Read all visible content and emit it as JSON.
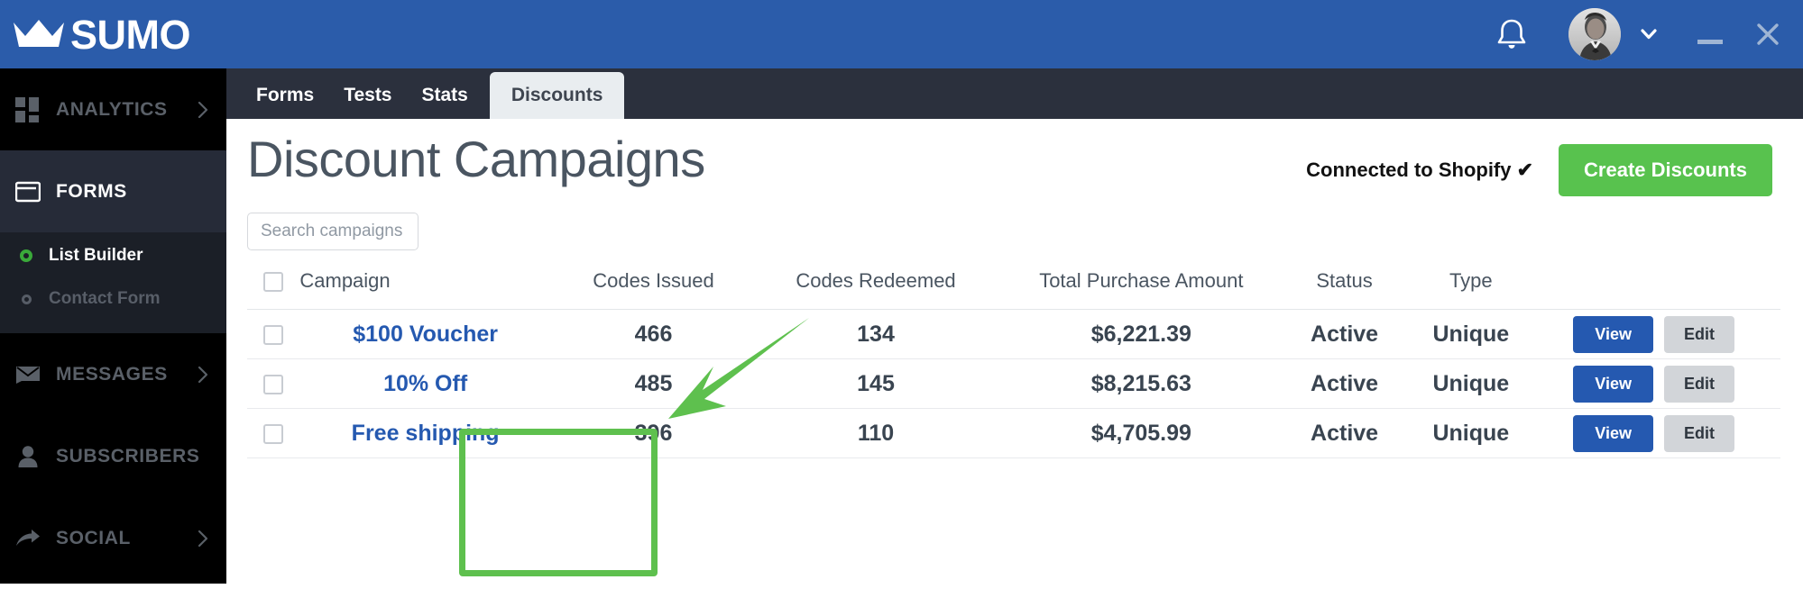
{
  "app": {
    "brand": "SUMO",
    "logo_icon": "crown-icon"
  },
  "titlebar": {
    "notifications_icon": "bell-icon",
    "avatar_icon": "user-avatar",
    "account_chevron_icon": "chevron-down-icon",
    "minimize_label": "–",
    "close_label": "✕"
  },
  "sidebar": {
    "items": [
      {
        "label": "ANALYTICS",
        "icon": "grid-icon",
        "has_chevron": true,
        "active": false
      },
      {
        "label": "FORMS",
        "icon": "window-icon",
        "has_chevron": false,
        "active": true
      },
      {
        "label": "MESSAGES",
        "icon": "envelope-icon",
        "has_chevron": true,
        "active": false
      },
      {
        "label": "SUBSCRIBERS",
        "icon": "person-icon",
        "has_chevron": false,
        "active": false
      },
      {
        "label": "SOCIAL",
        "icon": "share-arrow-icon",
        "has_chevron": true,
        "active": false
      }
    ],
    "subitems": [
      {
        "label": "List Builder",
        "active": true
      },
      {
        "label": "Contact Form",
        "active": false
      }
    ]
  },
  "tabs": [
    {
      "label": "Forms",
      "active": false
    },
    {
      "label": "Tests",
      "active": false
    },
    {
      "label": "Stats",
      "active": false
    },
    {
      "label": "Discounts",
      "active": true
    }
  ],
  "main": {
    "title": "Discount Campaigns",
    "shopify_status": "Connected to Shopify ✔",
    "create_button": "Create Discounts",
    "search_placeholder": "Search campaigns"
  },
  "table": {
    "headers": {
      "campaign": "Campaign",
      "codes_issued": "Codes Issued",
      "codes_redeemed": "Codes Redeemed",
      "total_purchase_amount": "Total Purchase Amount",
      "status": "Status",
      "type": "Type"
    },
    "row_actions": {
      "view": "View",
      "edit": "Edit"
    },
    "rows": [
      {
        "campaign": "$100 Voucher",
        "codes_issued": "466",
        "codes_redeemed": "134",
        "total_purchase_amount": "$6,221.39",
        "status": "Active",
        "type": "Unique"
      },
      {
        "campaign": "10% Off",
        "codes_issued": "485",
        "codes_redeemed": "145",
        "total_purchase_amount": "$8,215.63",
        "status": "Active",
        "type": "Unique"
      },
      {
        "campaign": "Free shipping",
        "codes_issued": "396",
        "codes_redeemed": "110",
        "total_purchase_amount": "$4,705.99",
        "status": "Active",
        "type": "Unique"
      }
    ]
  },
  "annotations": {
    "highlight_color": "#5ec04e",
    "arrow_color": "#5ec04e",
    "highlight_target": "campaign-name-column",
    "arrow_points_to": "campaign-name-column"
  },
  "colors": {
    "brand_blue": "#2b5caa",
    "sidebar_black": "#000000",
    "sidebar_active": "#262b38",
    "tabbar": "#2b303d",
    "tab_active_bg": "#e9edf0",
    "green_cta": "#58c24e",
    "link_blue": "#2559b0",
    "view_button": "#2559b0",
    "edit_button": "#d2d5d9"
  }
}
